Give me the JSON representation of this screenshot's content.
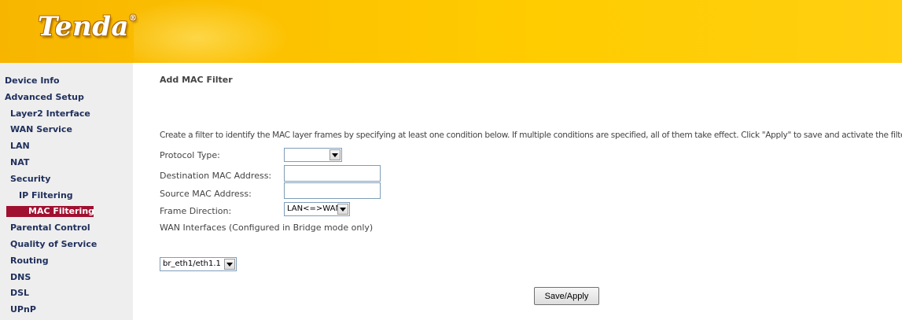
{
  "header": {
    "logo_text": "Tenda",
    "logo_mark": "®"
  },
  "sidebar": {
    "items": [
      {
        "label": "Device Info",
        "level": 0
      },
      {
        "label": "Advanced Setup",
        "level": 0
      },
      {
        "label": "Layer2 Interface",
        "level": 1
      },
      {
        "label": "WAN Service",
        "level": 1
      },
      {
        "label": "LAN",
        "level": 1
      },
      {
        "label": "NAT",
        "level": 1
      },
      {
        "label": "Security",
        "level": 1
      },
      {
        "label": "IP Filtering",
        "level": 2
      },
      {
        "label": "MAC Filtering",
        "level": 2,
        "active": true
      },
      {
        "label": "Parental Control",
        "level": 1
      },
      {
        "label": "Quality of Service",
        "level": 1
      },
      {
        "label": "Routing",
        "level": 1
      },
      {
        "label": "DNS",
        "level": 1
      },
      {
        "label": "DSL",
        "level": 1
      },
      {
        "label": "UPnP",
        "level": 1
      }
    ]
  },
  "main": {
    "title": "Add MAC Filter",
    "description": "Create a filter to identify the MAC layer frames by specifying at least one condition below. If multiple conditions are specified, all of them take effect. Click \"Apply\" to save and activate the filter",
    "fields": {
      "protocol_type": {
        "label": "Protocol Type:",
        "value": ""
      },
      "dest_mac": {
        "label": "Destination MAC Address:",
        "value": ""
      },
      "src_mac": {
        "label": "Source MAC Address:",
        "value": ""
      },
      "frame_direction": {
        "label": "Frame Direction:",
        "value": "LAN<=>WAN"
      }
    },
    "wan_interfaces": {
      "label": "WAN Interfaces (Configured in Bridge mode only)",
      "value": "br_eth1/eth1.1"
    },
    "save_button": "Save/Apply"
  },
  "colors": {
    "header": "#ffcc00",
    "sidebar_bg": "#eeeeee",
    "active_item": "#a01030",
    "nav_text": "#1f2f5c"
  }
}
